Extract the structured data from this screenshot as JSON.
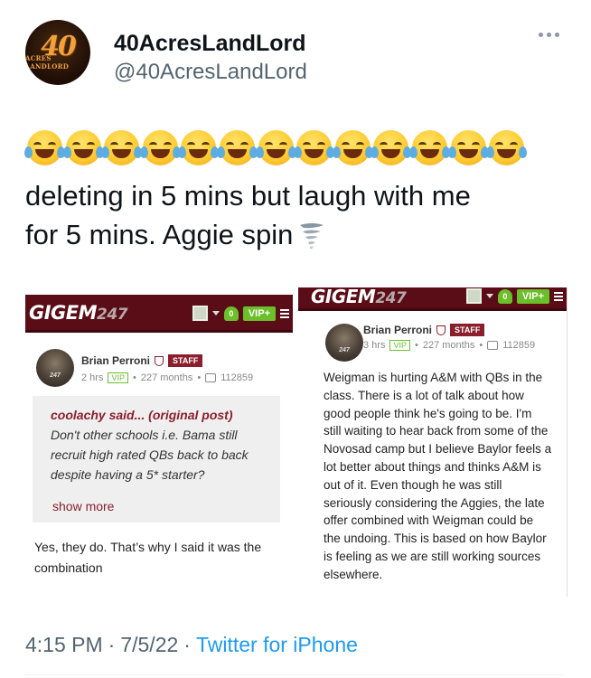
{
  "tweet": {
    "display_name": "40AcresLandLord",
    "handle": "@40AcresLandLord",
    "avatar_text": "40",
    "avatar_subtext": "ACRES LANDLORD",
    "emoji_count": 13,
    "text_line1": "deleting in 5 mins but laugh with me",
    "text_line2": "for 5 mins. Aggie spin",
    "time": "4:15 PM",
    "date": "7/5/22",
    "separator": "·",
    "source": "Twitter for iPhone"
  },
  "media": {
    "left": {
      "site_logo": "GIGEM",
      "site_logo_num": "247",
      "notif_count": "0",
      "vip_label": "VIP+",
      "author": "Brian Perroni",
      "staff_badge": "STAFF",
      "time_ago": "2 hrs",
      "vip_badge": "VIP",
      "tenure": "227 months",
      "post_count": "112859",
      "avatar_text": "247",
      "quote_by": "coolachy said... (original post)",
      "quote_body": "Don't other schools i.e. Bama still recruit high rated QBs back to back despite having a 5* starter?",
      "show_more": "show more",
      "reply": "Yes, they do. That’s why I said it was the combination"
    },
    "right": {
      "site_logo": "GIGEM",
      "site_logo_num": "247",
      "notif_count": "0",
      "vip_label": "VIP+",
      "author": "Brian Perroni",
      "staff_badge": "STAFF",
      "time_ago": "3 hrs",
      "vip_badge": "VIP",
      "tenure": "227 months",
      "post_count": "112859",
      "avatar_text": "247",
      "body": "Weigman is hurting A&M with QBs in the class. There is a lot of talk about how good people think he's going to be. I'm still waiting to hear back from some of the Novosad camp but I believe Baylor feels a lot better about things and thinks A&M is out of it. Even though he was still seriously considering the Aggies, the late offer combined with Weigman could be the undoing. This is based on how Baylor is feeling as we are still working sources elsewhere."
    }
  },
  "colors": {
    "link": "#1d9bf0",
    "muted": "#536471",
    "gigem_bar": "#5a0d17",
    "staff": "#8b1e2d",
    "vip_green": "#6bbf2a"
  },
  "icons": [
    "more-icon",
    "joy-emoji-icon",
    "tornado-icon",
    "shield-icon",
    "comment-icon",
    "bell-icon",
    "menu-icon"
  ]
}
